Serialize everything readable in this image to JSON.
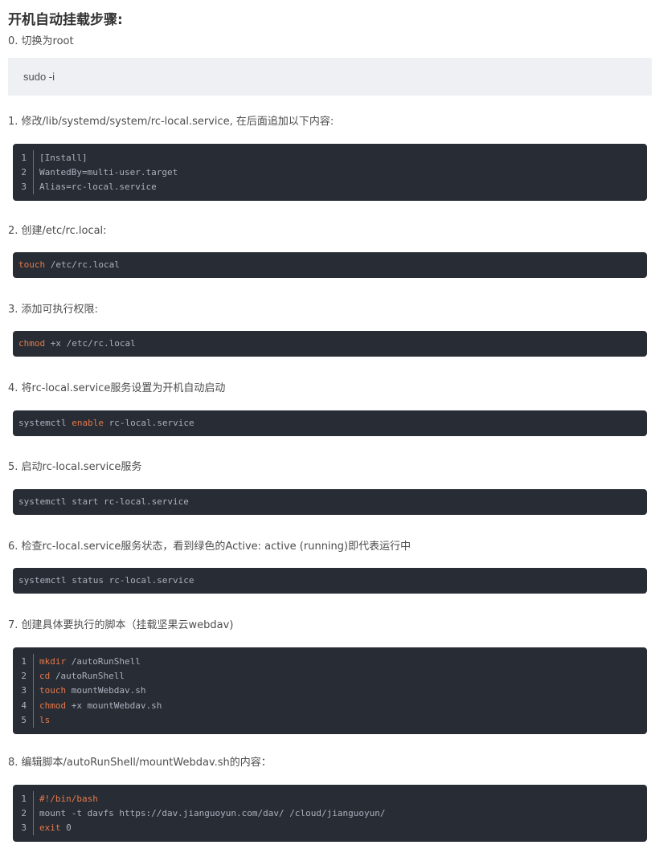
{
  "title": "开机自动挂载步骤:",
  "step0": {
    "text": "0. 切换为root",
    "quote": "sudo -i"
  },
  "step1": {
    "text": "1. 修改/lib/systemd/system/rc-local.service, 在后面追加以下内容:",
    "lines": [
      {
        "num": "1",
        "kw": "",
        "rest": "[Install]"
      },
      {
        "num": "2",
        "kw": "",
        "rest": "WantedBy=multi-user.target"
      },
      {
        "num": "3",
        "kw": "",
        "rest": "Alias=rc-local.service"
      }
    ]
  },
  "step2": {
    "text": "2. 创建/etc/rc.local:",
    "pre": "",
    "kw": "touch",
    "post": " /etc/rc.local"
  },
  "step3": {
    "text": "3. 添加可执行权限:",
    "pre": "",
    "kw": "chmod",
    "post": " +x /etc/rc.local"
  },
  "step4": {
    "text": "4. 将rc-local.service服务设置为开机自动启动",
    "pre": "systemctl ",
    "kw": "enable",
    "post": " rc-local.service"
  },
  "step5": {
    "text": "5. 启动rc-local.service服务",
    "pre": "systemctl start rc-local.service",
    "kw": "",
    "post": ""
  },
  "step6": {
    "text": "6. 检查rc-local.service服务状态，看到绿色的Active: active (running)即代表运行中",
    "pre": "systemctl status rc-local.service",
    "kw": "",
    "post": ""
  },
  "step7": {
    "text": "7. 创建具体要执行的脚本（挂载坚果云webdav)",
    "lines": [
      {
        "num": "1",
        "kw": "mkdir",
        "rest": " /autoRunShell"
      },
      {
        "num": "2",
        "kw": "cd",
        "rest": " /autoRunShell"
      },
      {
        "num": "3",
        "kw": "touch",
        "rest": " mountWebdav.sh"
      },
      {
        "num": "4",
        "kw": "chmod",
        "rest": " +x mountWebdav.sh"
      },
      {
        "num": "5",
        "kw": "ls",
        "rest": ""
      }
    ]
  },
  "step8": {
    "text": "8. 编辑脚本/autoRunShell/mountWebdav.sh的内容：",
    "lines": [
      {
        "num": "1",
        "kw": "#!/bin/bash",
        "rest": ""
      },
      {
        "num": "2",
        "kw": "",
        "rest": "mount -t davfs https://dav.jianguoyun.com/dav/ /cloud/jianguoyun/"
      },
      {
        "num": "3",
        "kw": "exit",
        "rest": " 0"
      }
    ]
  },
  "colors": {
    "code_bg": "#282c34",
    "keyword": "#e5794b",
    "quote_bg": "#eef0f4"
  }
}
